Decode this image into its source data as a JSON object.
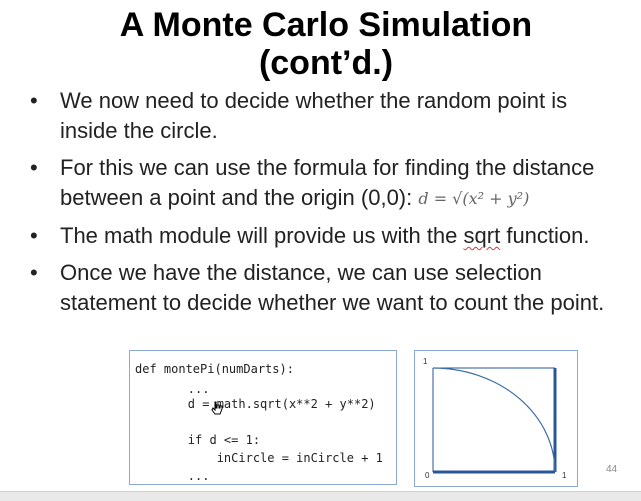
{
  "slide": {
    "title_line1": "A Monte Carlo Simulation",
    "title_line2": "(cont’d.)",
    "bullets": [
      {
        "text": "We now need to decide whether the random point is inside the circle."
      },
      {
        "text_before": "For this we can use the formula for finding the distance between a point and the origin (0,0): ",
        "formula": "d = √(x² + y²)"
      },
      {
        "text_before": "The math module will provide us with the ",
        "underlined": "sqrt",
        "text_after": " function."
      },
      {
        "text": "Once we have the distance, we can use selection statement to decide whether we want to count the point."
      }
    ],
    "bullet_glyph": "•",
    "slide_number": "44"
  },
  "code": {
    "lines": [
      "def montePi(numDarts):",
      "        ...",
      "        d = math.sqrt(x**2 + y**2)",
      "",
      "        if d <= 1:",
      "            inCircle = inCircle + 1",
      "        ..."
    ]
  },
  "plot": {
    "y_top_label": "1",
    "origin_label": "0",
    "x_right_label": "1",
    "curve_color": "#3a6ea8",
    "axis_color": "#2a5599"
  },
  "colors": {
    "box_border": "#8aa9d6",
    "spell_underline": "#d23a3a"
  }
}
